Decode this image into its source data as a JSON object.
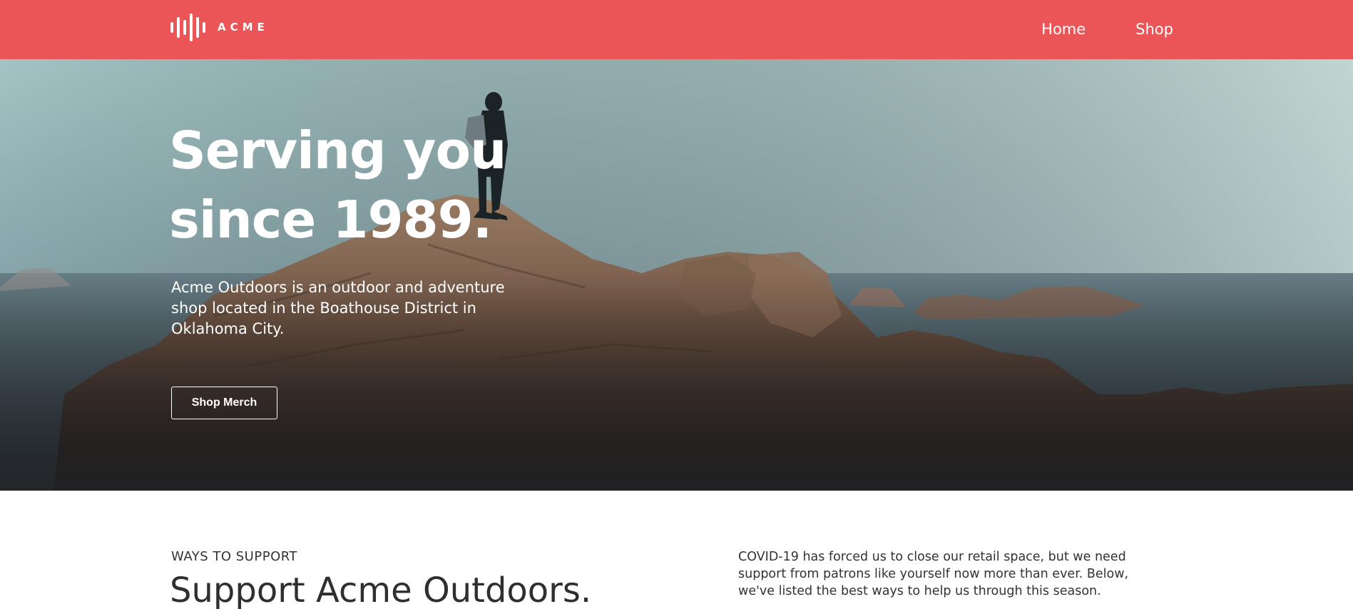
{
  "brand": {
    "name": "ACME",
    "logo_icon": "sound-wave-logo-icon"
  },
  "nav": {
    "items": [
      {
        "label": "Home"
      },
      {
        "label": "Shop"
      }
    ]
  },
  "hero": {
    "title": "Serving you since 1989.",
    "description": "Acme Outdoors is an outdoor and adventure shop located in the Boathouse District in Oklahoma City.",
    "button_label": "Shop Merch"
  },
  "support": {
    "eyebrow": "WAYS TO SUPPORT",
    "title": "Support Acme Outdoors.",
    "description": "COVID-19 has forced us to close our retail space, but we need support from patrons like yourself now more than ever. Below, we've listed the best ways to help us through this season."
  },
  "colors": {
    "header_bg": "#ec5557",
    "text_light": "#ffffff",
    "text_dark": "#333333"
  }
}
